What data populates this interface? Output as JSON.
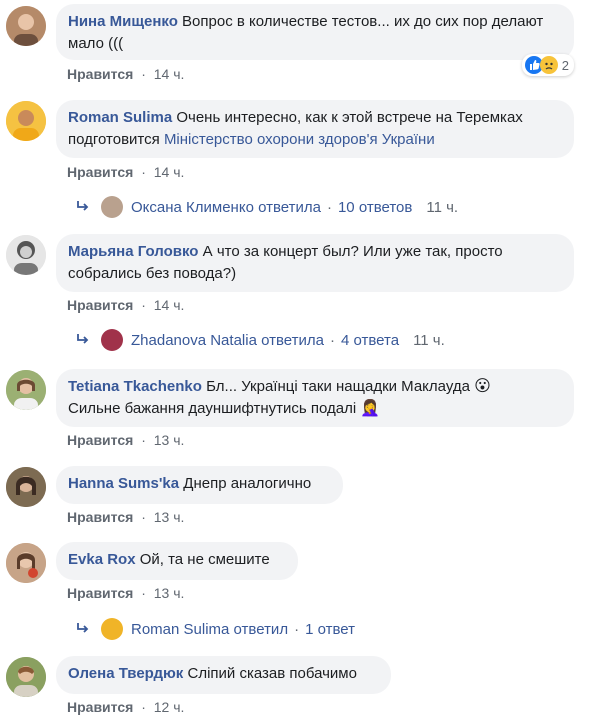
{
  "colors": {
    "link": "#385898",
    "bubble": "#f2f3f5",
    "meta": "#606770"
  },
  "comments": [
    {
      "author": "Нина Мищенко",
      "text": "Вопрос в количестве тестов... их до сих пор делают мало (((",
      "like": "Нравится",
      "time": "14 ч.",
      "reactions_count": "2"
    },
    {
      "author": "Roman Sulima",
      "text_before": "Очень интересно, как к этой встрече на Теремках подготовится",
      "page_link": "Міністерство охорони здоров'я України",
      "like": "Нравится",
      "time": "14 ч.",
      "reply": {
        "name": "Оксана Клименко ответила",
        "count": "10 ответов",
        "time": "11 ч."
      }
    },
    {
      "author": "Марьяна Головко",
      "text": "А что за концерт был? Или уже так, просто собрались без повода?)",
      "like": "Нравится",
      "time": "14 ч.",
      "reply": {
        "name": "Zhadanova Natalia ответила",
        "count": "4 ответа",
        "time": "11 ч."
      }
    },
    {
      "author": "Tetiana Tkachenko",
      "text_line1": "Бл... Українці таки нащадки Маклауда",
      "text_line2": "Сильне бажання дауншифтнутись подалі",
      "emoji1": "😮",
      "emoji2": "🤦‍♀️",
      "like": "Нравится",
      "time": "13 ч."
    },
    {
      "author": "Hanna Sums'ka",
      "text": "Днепр аналогично",
      "like": "Нравится",
      "time": "13 ч."
    },
    {
      "author": "Evka Rox",
      "text": "Ой, та не смешите",
      "like": "Нравится",
      "time": "13 ч.",
      "reply": {
        "name": "Roman Sulima ответил",
        "count": "1 ответ"
      }
    },
    {
      "author": "Олена Твердюк",
      "text": "Сліпий сказав побачимо",
      "like": "Нравится",
      "time": "12 ч."
    }
  ]
}
